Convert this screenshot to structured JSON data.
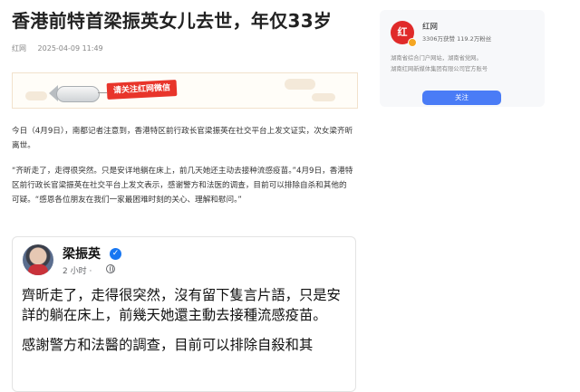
{
  "article": {
    "title": "香港前特首梁振英女儿去世，年仅33岁",
    "source": "红网",
    "date": "2025-04-09 11:49",
    "banner_text": "请关注红网微信",
    "paragraph1": "今日（4月9日），南都记者注意到，香港特区前行政长官梁振英在社交平台上发文证实，次女梁齐昕离世。",
    "paragraph2": "“齐昕走了，走得很突然。只是安详地躺在床上，前几天她还主动去接种流感疫苗。”4月9日，香港特区前行政长官梁振英在社交平台上发文表示，感谢警方和法医的调查，目前可以排除自杀和其他的可疑。“感恩各位朋友在我们一家最困难时刻的关心、理解和慰问。”"
  },
  "post": {
    "author": "梁振英",
    "time": "2 小时 ·",
    "line1": "齊昕走了，走得很突然，沒有留下隻言片語，只是安詳的躺在床上，前幾天她還主動去接種流感疫苗。",
    "line2": "感謝警方和法醫的調查，目前可以排除自殺和其"
  },
  "sidebar": {
    "logo_text": "红",
    "account_name": "红网",
    "stats": "3306万获赞 119.2万粉丝",
    "desc1": "湖南省综合门户网站，湖南省党网。",
    "desc2": "湖南红网新媒体集团有限公司官方账号",
    "follow_label": "关注"
  },
  "colors": {
    "accent_blue": "#4a7cf6",
    "brand_red": "#e02a2a",
    "banner_red": "#e8352b",
    "verified_blue": "#1877f2"
  }
}
